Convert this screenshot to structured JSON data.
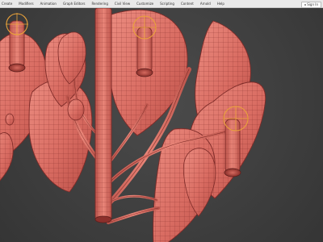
{
  "menu": {
    "items": [
      "Create",
      "Modifiers",
      "Animation",
      "Graph Editors",
      "Rendering",
      "Civil View",
      "Customize",
      "Scripting",
      "Content",
      "Arnold",
      "Help"
    ],
    "sign_in": "Sign In"
  },
  "viewport": {
    "mesh_color": "#d96c62",
    "mesh_shadow": "#b94e46",
    "wire_color": "#7e2b28",
    "gizmo_color": "#e9a23a"
  }
}
